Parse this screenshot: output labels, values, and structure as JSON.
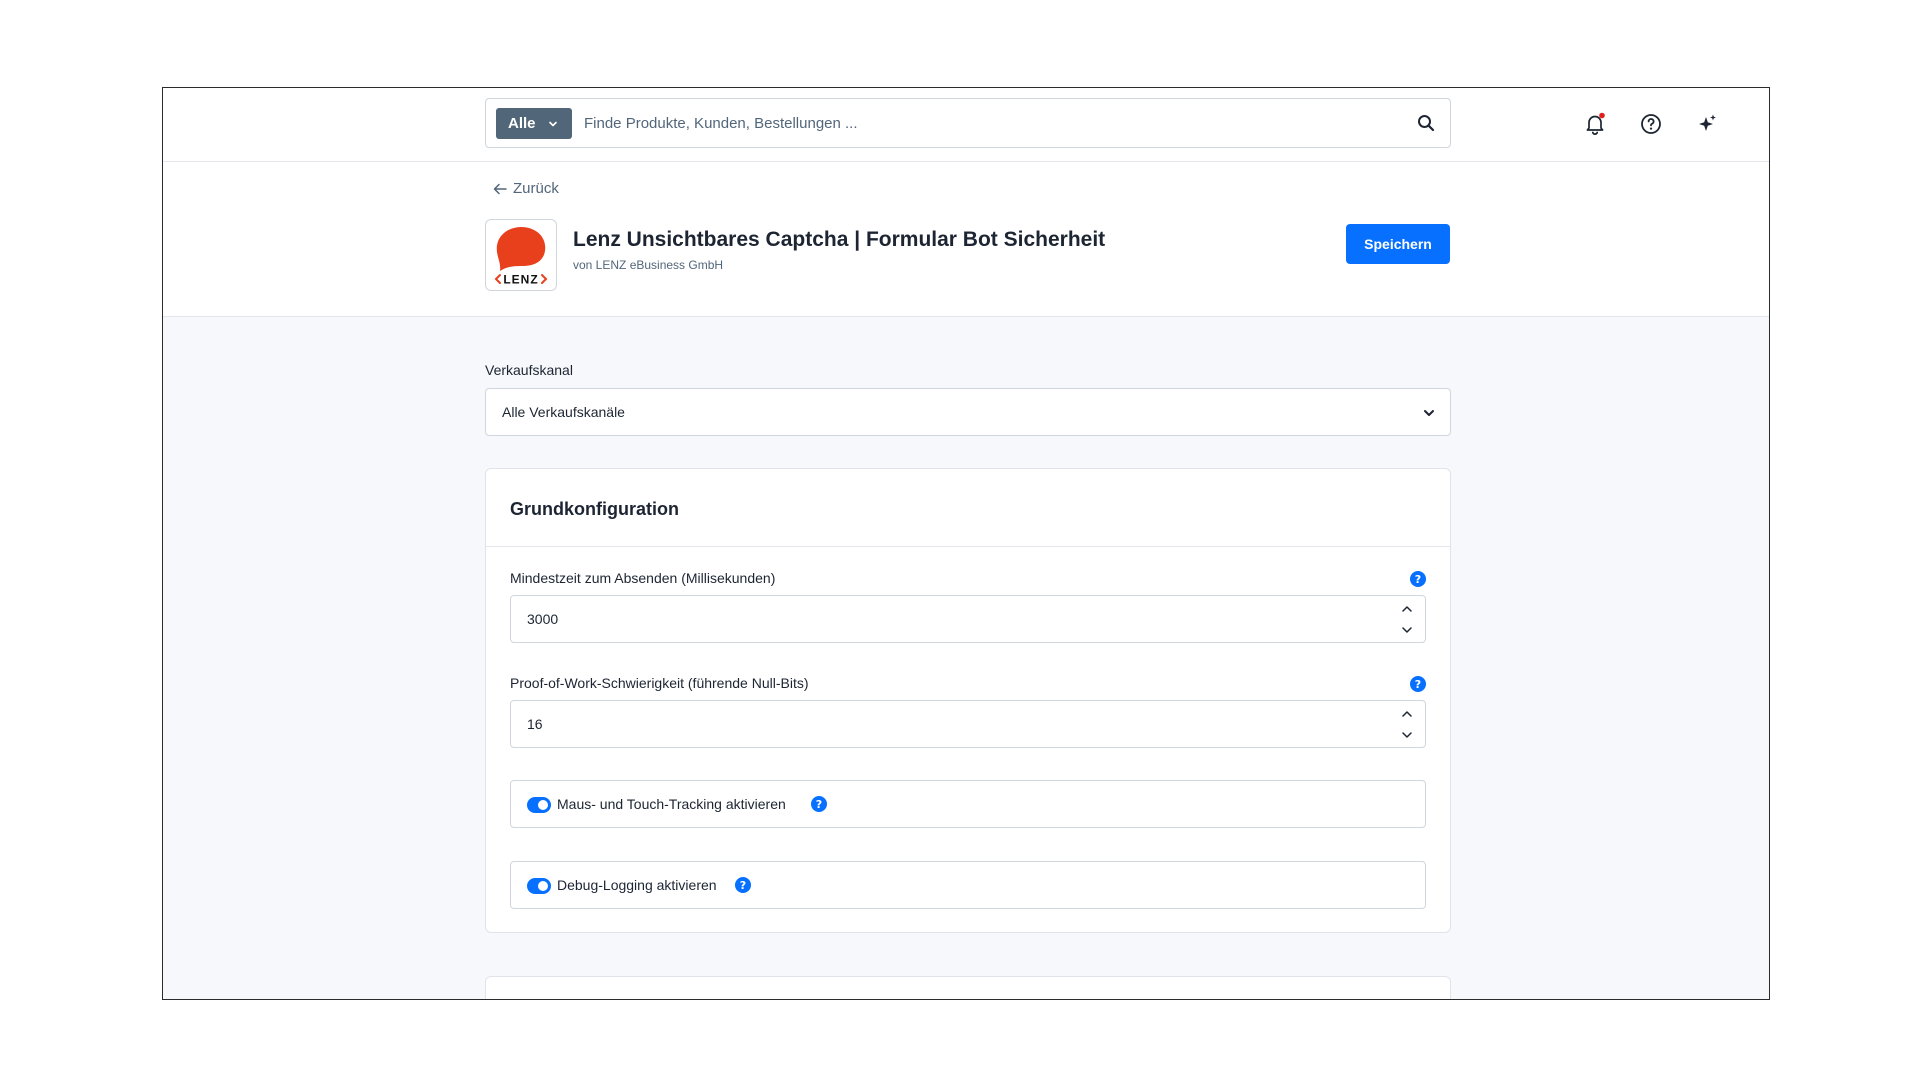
{
  "topbar": {
    "scope_label": "Alle",
    "search_placeholder": "Finde Produkte, Kunden, Bestellungen ..."
  },
  "header": {
    "back_label": "Zurück",
    "title": "Lenz Unsichtbares Captcha | Formular Bot Sicherheit",
    "vendor": "von LENZ eBusiness GmbH",
    "logo_text": "LENZ",
    "save_label": "Speichern"
  },
  "saleschannel": {
    "label": "Verkaufskanal",
    "selected": "Alle Verkaufskanäle"
  },
  "config": {
    "title": "Grundkonfiguration",
    "fields": [
      {
        "label": "Mindestzeit zum Absenden (Millisekunden)",
        "value": "3000"
      },
      {
        "label": "Proof-of-Work-Schwierigkeit (führende Null-Bits)",
        "value": "16"
      }
    ],
    "toggles": [
      {
        "label": "Maus- und Touch-Tracking aktivieren",
        "enabled": true
      },
      {
        "label": "Debug-Logging aktivieren",
        "enabled": true
      }
    ],
    "help_glyph": "?"
  },
  "colors": {
    "accent": "#0870ff",
    "scope_button": "#52667a",
    "notification_dot": "#e0201b",
    "logo_red": "#e8401c"
  }
}
